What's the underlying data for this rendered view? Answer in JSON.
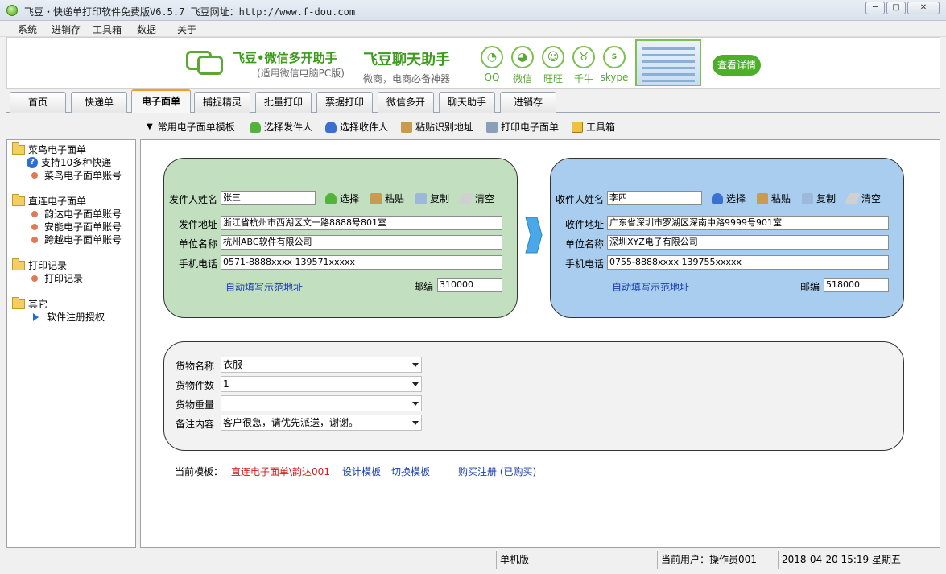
{
  "window": {
    "title": "飞豆・快递单打印软件免费版V6.5.7  飞豆网址：http://www.f-dou.com"
  },
  "menu": [
    "系统",
    "进销存",
    "工具箱",
    "数据",
    "关于"
  ],
  "banner": {
    "product1": "飞豆•微信多开助手",
    "product1_sub": "(适用微信电脑PC版)",
    "product2": "飞豆聊天助手",
    "product2_sub": "微商，电商必备神器",
    "apps": [
      {
        "label": "QQ",
        "icon": "qq-icon"
      },
      {
        "label": "微信",
        "icon": "wechat-icon"
      },
      {
        "label": "旺旺",
        "icon": "wangwang-icon"
      },
      {
        "label": "千牛",
        "icon": "qianniu-icon"
      },
      {
        "label": "skype",
        "icon": "skype-icon"
      }
    ],
    "detail_button": "查看详情"
  },
  "tabs": [
    "首页",
    "快递单",
    "电子面单",
    "捕捉精灵",
    "批量打印",
    "票据打印",
    "微信多开",
    "聊天助手",
    "进销存"
  ],
  "active_tab": "电子面单",
  "toolbar": {
    "template_dropdown": "常用电子面单模板",
    "select_sender": "选择发件人",
    "select_receiver": "选择收件人",
    "paste_parse": "粘贴识别地址",
    "print": "打印电子面单",
    "tools": "工具箱"
  },
  "sidebar": {
    "groups": [
      {
        "label": "菜鸟电子面单",
        "items": [
          "支持10多种快递",
          "菜鸟电子面单账号"
        ]
      },
      {
        "label": "直连电子面单",
        "items": [
          "韵达电子面单账号",
          "安能电子面单账号",
          "跨越电子面单账号"
        ]
      },
      {
        "label": "打印记录",
        "items": [
          "打印记录"
        ]
      },
      {
        "label": "其它",
        "items": [
          "软件注册授权"
        ]
      }
    ]
  },
  "sender": {
    "name_label": "发件人姓名",
    "name": "张三",
    "select": "选择",
    "paste": "粘贴",
    "copy": "复制",
    "clear": "清空",
    "address_label": "发件地址",
    "address": "浙江省杭州市西湖区文一路8888号801室",
    "company_label": "单位名称",
    "company": "杭州ABC软件有限公司",
    "phone_label": "手机电话",
    "phone": "0571-8888xxxx 139571xxxxx",
    "auto_fill": "自动填写示范地址",
    "postcode_label": "邮编",
    "postcode": "310000",
    "bg_color": "#c2dfc0"
  },
  "receiver": {
    "name_label": "收件人姓名",
    "name": "李四",
    "select": "选择",
    "paste": "粘贴",
    "copy": "复制",
    "clear": "清空",
    "address_label": "收件地址",
    "address": "广东省深圳市罗湖区深南中路9999号901室",
    "company_label": "单位名称",
    "company": "深圳XYZ电子有限公司",
    "phone_label": "手机电话",
    "phone": "0755-8888xxxx 139755xxxxx",
    "auto_fill": "自动填写示范地址",
    "postcode_label": "邮编",
    "postcode": "518000",
    "bg_color": "#a9cdef"
  },
  "goods": {
    "name_label": "货物名称",
    "name": "衣服",
    "count_label": "货物件数",
    "count": "1",
    "weight_label": "货物重量",
    "weight": "",
    "remark_label": "备注内容",
    "remark": "客户很急，请优先派送，谢谢。"
  },
  "template_bar": {
    "label": "当前模板：",
    "current": "直连电子面单\\韵达001",
    "design": "设计模板",
    "switch": "切换模板",
    "purchase": "购买注册 (已购买)"
  },
  "status": {
    "mode": "单机版",
    "user": "当前用户：操作员001",
    "datetime": "2018-04-20 15:19 星期五"
  }
}
